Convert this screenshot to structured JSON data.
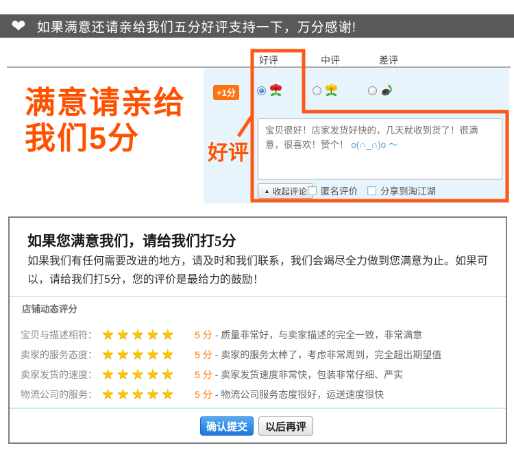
{
  "icons": {
    "heart": "❤",
    "star": "★",
    "triangle_up": "▲"
  },
  "colors": {
    "banner_bg": "#58595b",
    "accent_orange": "#ff5000",
    "highlight_box": "#fa5a17",
    "panel_blue": "#e8f4fb",
    "star_gold": "#fec600",
    "score_orange": "#ff7a00",
    "submit_blue": "#1b79dd"
  },
  "banner": {
    "text": "如果满意还请亲给我们五分好评支持一下，万分感谢!"
  },
  "promo": {
    "headline_line1": "满意请亲给",
    "headline_line2": "我们5分",
    "callout_label": "好评"
  },
  "rating_widget": {
    "tabs": [
      {
        "label": "好评"
      },
      {
        "label": "中评"
      },
      {
        "label": "差评"
      }
    ],
    "score_badge": "+1分",
    "review_text": "宝贝很好！店家发货好快的，几天就收到货了！很满意，很喜欢！赞个！",
    "review_emoticon": "o(∩_∩)o ～",
    "collapse_button": "收起评论",
    "checkboxes": [
      {
        "label": "匿名评价",
        "checked": false
      },
      {
        "label": "分享到淘江湖",
        "checked": false
      }
    ]
  },
  "feedback_card": {
    "title": "如果您满意我们，请给我们打5分",
    "body": "如果我们有任何需要改进的地方，请及时和我们联系，我们会竭尽全力做到您满意为止。如果可以，请给我们打5分，您的评价是最给力的鼓励！",
    "section_title": "店铺动态评分",
    "ratings": [
      {
        "label": "宝贝与描述相符：",
        "stars": 5,
        "score": "5 分",
        "desc": "- 质量非常好，与卖家描述的完全一致，非常满意"
      },
      {
        "label": "卖家的服务态度：",
        "stars": 5,
        "score": "5 分",
        "desc": "- 卖家的服务太棒了，考虑非常周到，完全超出期望值"
      },
      {
        "label": "卖家发货的速度：",
        "stars": 5,
        "score": "5 分",
        "desc": "- 卖家发货速度非常快，包装非常仔细、严实"
      },
      {
        "label": "物流公司的服务：",
        "stars": 5,
        "score": "5 分",
        "desc": "- 物流公司服务态度很好，运送速度很快"
      }
    ],
    "submit_button": "确认提交",
    "later_button": "以后再评"
  }
}
